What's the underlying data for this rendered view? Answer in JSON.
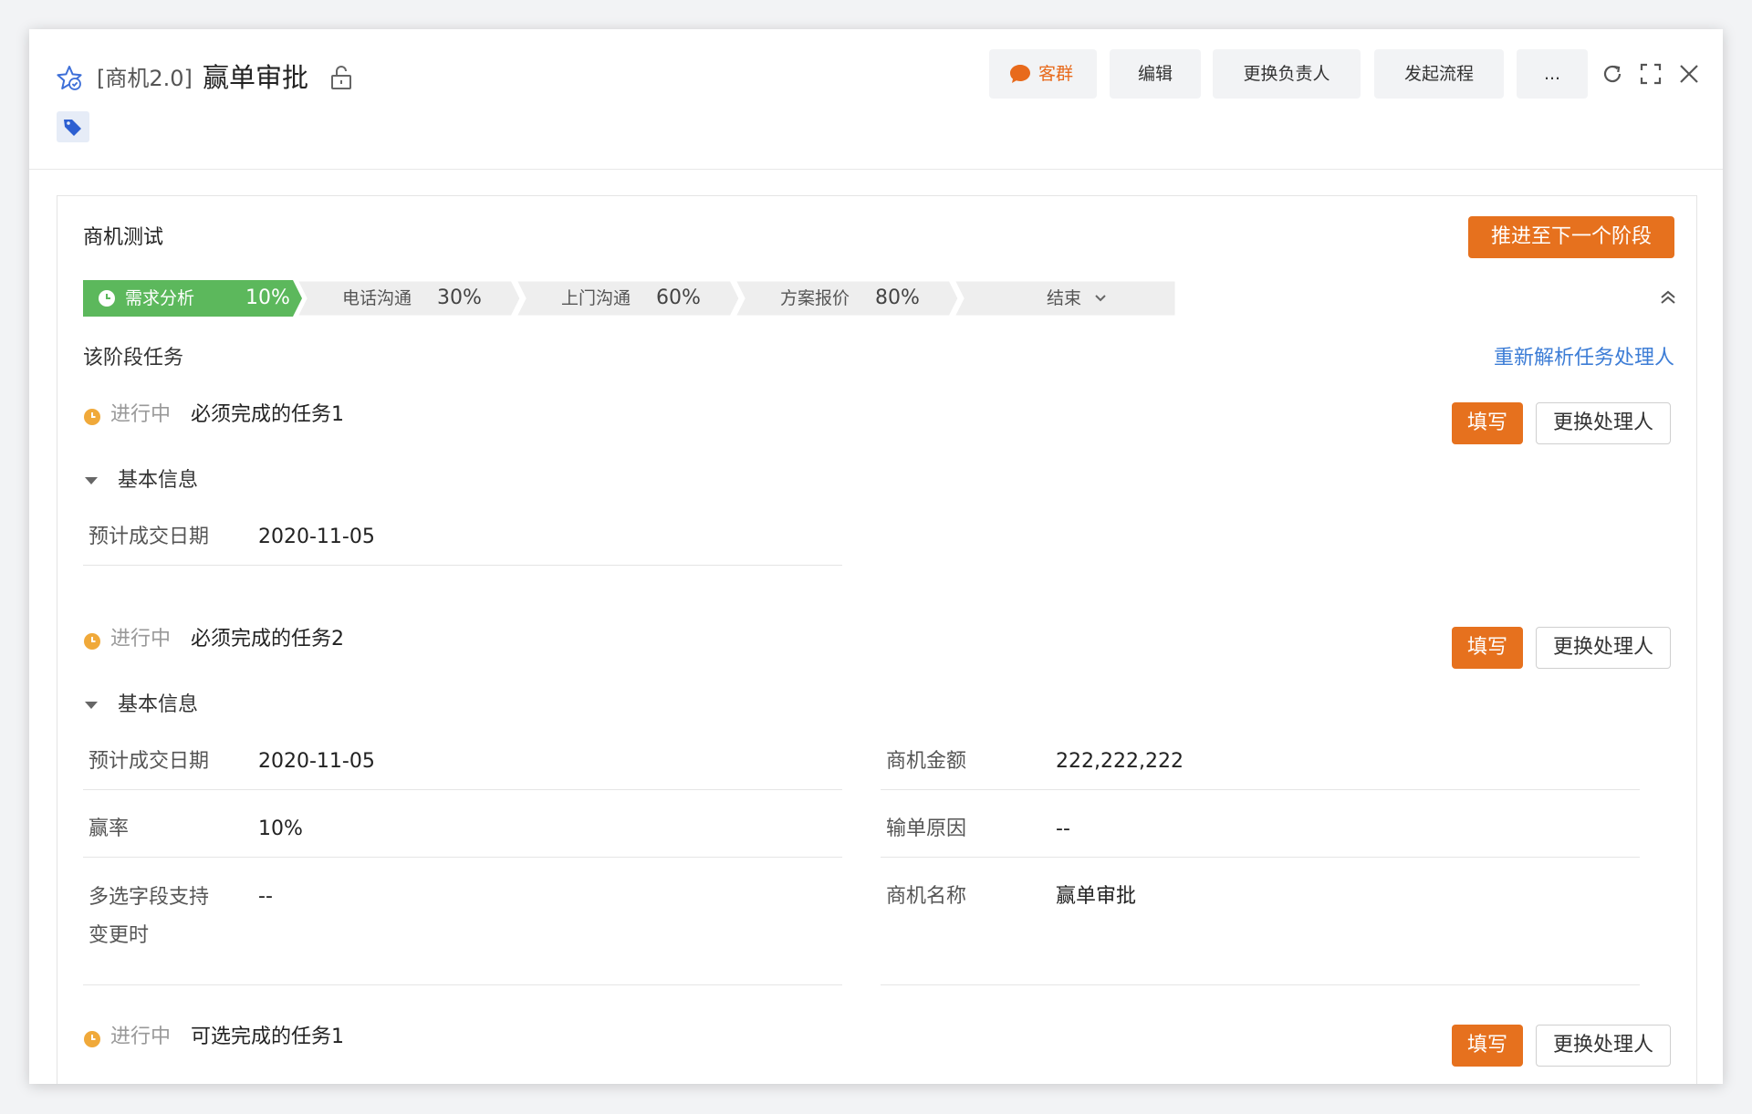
{
  "header": {
    "title_prefix": "[商机2.0]",
    "title": "赢单审批",
    "buttons": {
      "kequn": "客群",
      "edit": "编辑",
      "change_owner": "更换负责人",
      "start_flow": "发起流程",
      "more": "..."
    }
  },
  "card": {
    "title": "商机测试",
    "advance_label": "推进至下一个阶段",
    "stages": [
      {
        "name": "需求分析",
        "percent": "10%",
        "active": true
      },
      {
        "name": "电话沟通",
        "percent": "30%",
        "active": false
      },
      {
        "name": "上门沟通",
        "percent": "60%",
        "active": false
      },
      {
        "name": "方案报价",
        "percent": "80%",
        "active": false
      },
      {
        "name": "结束",
        "percent": "",
        "active": false
      }
    ],
    "section_label": "该阶段任务",
    "reparse_label": "重新解析任务处理人",
    "tasks": [
      {
        "status": "进行中",
        "name": "必须完成的任务1",
        "fill_label": "填写",
        "change_label": "更换处理人",
        "group": "基本信息",
        "fields": [
          {
            "label": "预计成交日期",
            "value": "2020-11-05"
          }
        ]
      },
      {
        "status": "进行中",
        "name": "必须完成的任务2",
        "fill_label": "填写",
        "change_label": "更换处理人",
        "group": "基本信息",
        "fields": [
          {
            "label": "预计成交日期",
            "value": "2020-11-05"
          },
          {
            "label": "商机金额",
            "value": "222,222,222"
          },
          {
            "label": "赢率",
            "value": "10%"
          },
          {
            "label": "输单原因",
            "value": "--"
          },
          {
            "label": "多选字段支持变更时",
            "value": "--"
          },
          {
            "label": "商机名称",
            "value": "赢单审批"
          }
        ]
      },
      {
        "status": "进行中",
        "name": "可选完成的任务1",
        "fill_label": "填写",
        "change_label": "更换处理人"
      }
    ]
  },
  "colors": {
    "accent_orange": "#e6711e",
    "stage_active_green": "#5cb85c",
    "link_blue": "#3d7dd6",
    "status_orange": "#f0a93a"
  }
}
